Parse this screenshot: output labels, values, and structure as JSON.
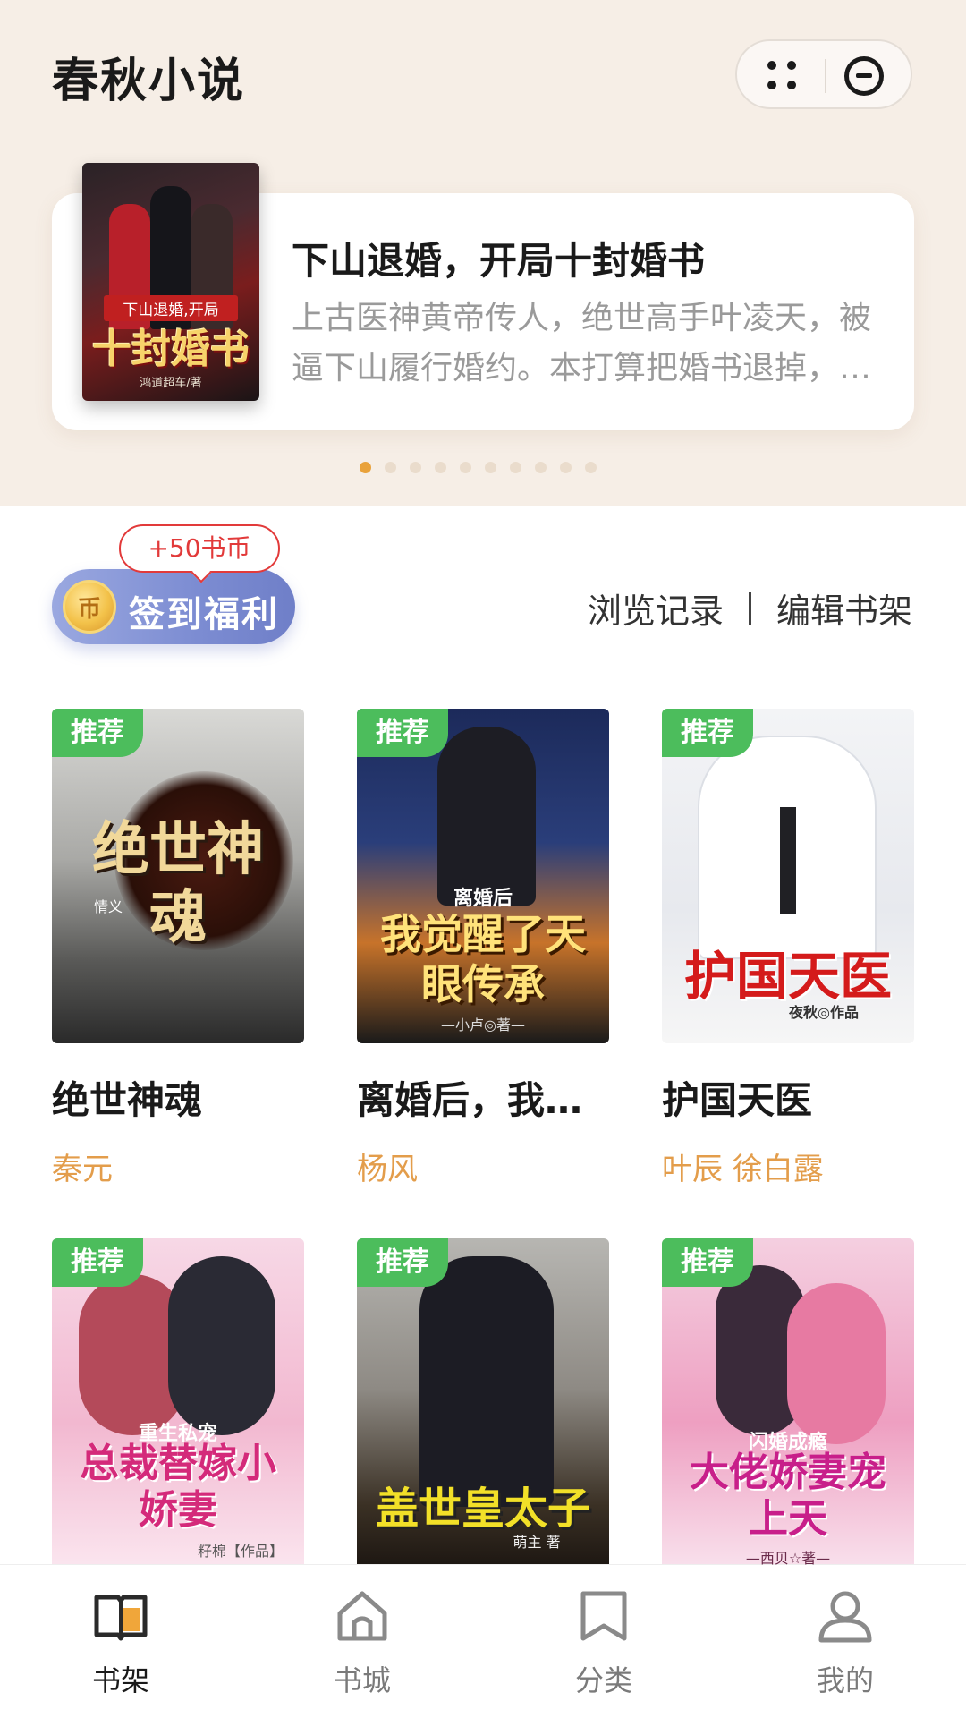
{
  "header": {
    "app_title": "春秋小说"
  },
  "banner": {
    "title": "下山退婚，开局十封婚书",
    "description": "上古医神黄帝传人，绝世高手叶凌天，被逼下山履行婚约。本打算把婚书退掉，没想到十个未婚妻个个都是绝色美女……",
    "cover": {
      "tagline": "下山退婚,开局",
      "title": "十封婚书",
      "author": "鸿道超车/著"
    },
    "page_count": 10,
    "active_page": 0
  },
  "checkin": {
    "label": "签到福利",
    "coin_symbol": "币",
    "bonus": "+50书币"
  },
  "actions": {
    "history": "浏览记录",
    "separator": "|",
    "edit": "编辑书架"
  },
  "books": [
    {
      "tag": "推荐",
      "title": "绝世神魂",
      "author": "秦元",
      "cover_text": "绝世神魂",
      "cover_sub": "情义"
    },
    {
      "tag": "推荐",
      "title": "离婚后，我…",
      "author": "杨风",
      "cover_text": "我觉醒了天眼传承",
      "cover_sub": "离婚后",
      "cover_author": "—小卢◎著—"
    },
    {
      "tag": "推荐",
      "title": "护国天医",
      "author": "叶辰 徐白露",
      "cover_text": "护国天医",
      "cover_author": "夜秋◎作品"
    },
    {
      "tag": "推荐",
      "title": "",
      "author": "",
      "cover_text": "总裁替嫁小娇妻",
      "cover_sub": "重生私宠",
      "cover_author": "籽棉【作品】"
    },
    {
      "tag": "推荐",
      "title": "",
      "author": "",
      "cover_text": "盖世皇太子",
      "cover_author": "萌主 著"
    },
    {
      "tag": "推荐",
      "title": "",
      "author": "",
      "cover_text": "大佬娇妻宠上天",
      "cover_sub": "闪婚成瘾",
      "cover_author": "—西贝☆著—"
    }
  ],
  "tabbar": {
    "items": [
      {
        "label": "书架",
        "icon": "book-open-icon",
        "active": true
      },
      {
        "label": "书城",
        "icon": "home-icon",
        "active": false
      },
      {
        "label": "分类",
        "icon": "bookmark-icon",
        "active": false
      },
      {
        "label": "我的",
        "icon": "user-icon",
        "active": false
      }
    ]
  },
  "colors": {
    "accent": "#e9a23b",
    "author": "#e39d4b",
    "tag_green": "#4cbd5c",
    "checkin_blue": "#7c8cd2",
    "bonus_red": "#e23a3a",
    "top_bg": "#f6eee6"
  }
}
